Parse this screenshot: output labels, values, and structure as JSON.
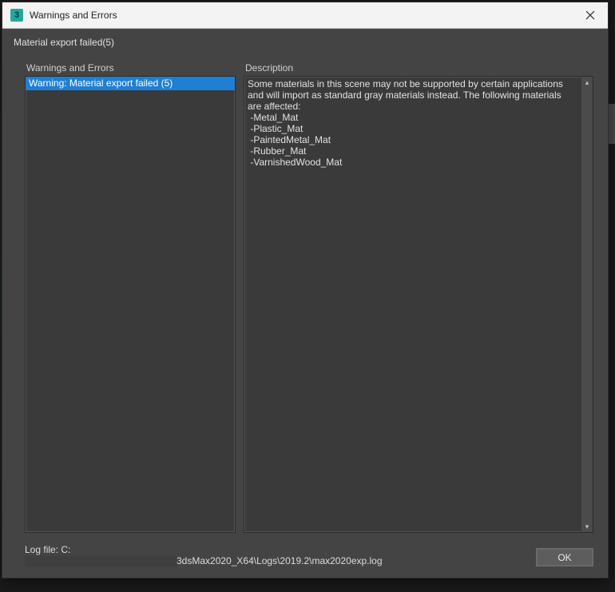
{
  "window": {
    "app_icon_letter": "3",
    "title": "Warnings and Errors"
  },
  "summary_line": "Material export failed(5)",
  "panels": {
    "left_label": "Warnings and Errors",
    "right_label": "Description",
    "warnings": [
      {
        "label": "Warning: Material export failed (5)",
        "selected": true
      }
    ],
    "description_text": "Some materials in this scene may not be supported by certain applications and will import as standard gray materials instead. The following materials are affected:\n -Metal_Mat\n -Plastic_Mat\n -PaintedMetal_Mat\n -Rubber_Mat\n -VarnishedWood_Mat"
  },
  "footer": {
    "log_label": "Log file: C:",
    "log_tail": "3dsMax2020_X64\\Logs\\2019.2\\max2020exp.log",
    "ok_label": "OK"
  }
}
